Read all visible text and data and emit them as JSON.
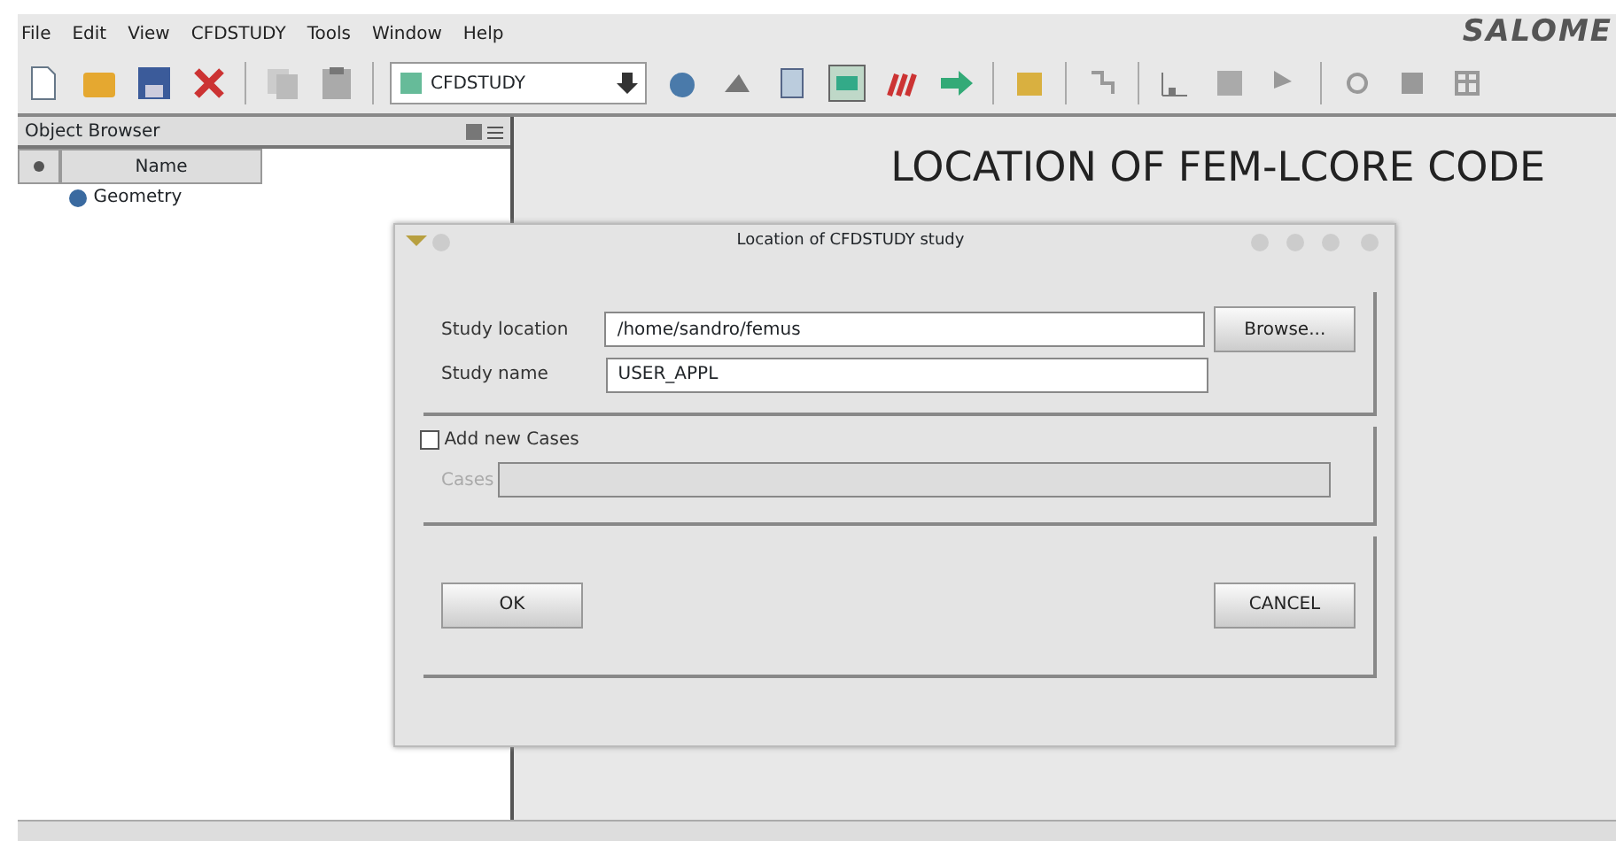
{
  "menu": [
    "File",
    "Edit",
    "View",
    "CFDSTUDY",
    "Tools",
    "Window",
    "Help"
  ],
  "logo": "SALOME",
  "toolbar": {
    "module_combo": "CFDSTUDY"
  },
  "object_browser": {
    "title": "Object Browser",
    "column": "Name",
    "tree": [
      {
        "label": "Geometry"
      }
    ]
  },
  "heading": "LOCATION OF FEM-LCORE CODE",
  "dialog": {
    "title": "Location of CFDSTUDY study",
    "fields": [
      {
        "label": "Study location",
        "value": "/home/sandro/femus"
      },
      {
        "label": "Study name",
        "value": "USER_APPL"
      }
    ],
    "browse_button": "Browse...",
    "add_cases": {
      "label": "Add new Cases",
      "checked": false
    },
    "cases": {
      "label": "Cases",
      "disabled": true
    },
    "buttons": [
      "OK",
      "CANCEL"
    ]
  }
}
